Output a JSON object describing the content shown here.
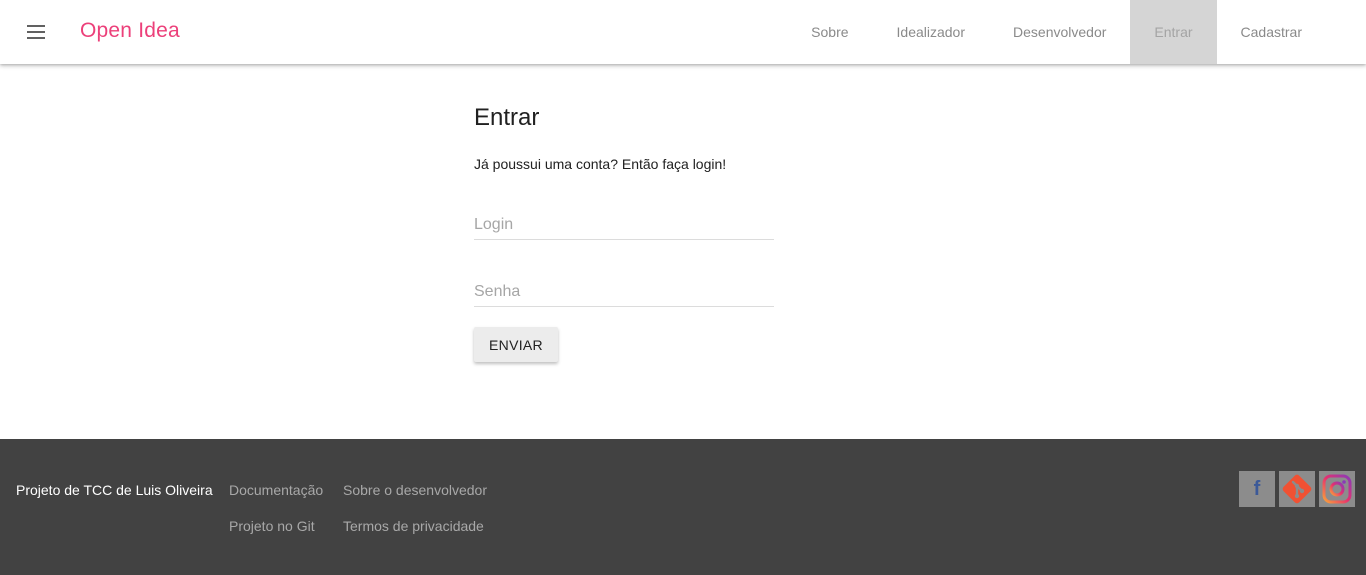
{
  "header": {
    "brand": "Open Idea",
    "nav": [
      {
        "label": "Sobre"
      },
      {
        "label": "Idealizador"
      },
      {
        "label": "Desenvolvedor"
      },
      {
        "label": "Entrar",
        "active": true
      },
      {
        "label": "Cadastrar"
      }
    ]
  },
  "login": {
    "title": "Entrar",
    "subtitle": "Já poussui uma conta? Então faça login!",
    "login_placeholder": "Login",
    "login_value": "",
    "senha_placeholder": "Senha",
    "senha_value": "",
    "submit_label": "ENVIAR"
  },
  "footer": {
    "credit": "Projeto de TCC de Luis Oliveira",
    "links": {
      "documentacao": "Documentação",
      "sobre_dev": "Sobre o desenvolvedor",
      "git": "Projeto no Git",
      "privacidade": "Termos de privacidade"
    },
    "social_icons": [
      "facebook-icon",
      "git-icon",
      "instagram-icon"
    ]
  },
  "colors": {
    "brand": "#ec407a",
    "footer_bg": "#424242",
    "nav_active_bg": "#d5d5d5",
    "button_bg": "#ececec",
    "facebook": "#3b5998",
    "git": "#f05133"
  }
}
